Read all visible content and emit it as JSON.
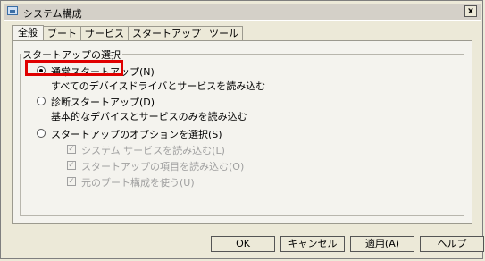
{
  "window": {
    "title": "システム構成",
    "close_label": "x"
  },
  "tabs": [
    {
      "label": "全般"
    },
    {
      "label": "ブート"
    },
    {
      "label": "サービス"
    },
    {
      "label": "スタートアップ"
    },
    {
      "label": "ツール"
    }
  ],
  "startup_group": {
    "title": "スタートアップの選択",
    "options": [
      {
        "label": "通常スタートアップ(N)",
        "description": "すべてのデバイスドライバとサービスを読み込む",
        "selected": true
      },
      {
        "label": "診断スタートアップ(D)",
        "description": "基本的なデバイスとサービスのみを読み込む",
        "selected": false
      },
      {
        "label": "スタートアップのオプションを選択(S)",
        "description": "",
        "selected": false
      }
    ],
    "sub_options": [
      {
        "label": "システム サービスを読み込む(L)",
        "checked": true
      },
      {
        "label": "スタートアップの項目を読み込む(O)",
        "checked": true
      },
      {
        "label": "元のブート構成を使う(U)",
        "checked": true
      }
    ]
  },
  "buttons": {
    "ok": "OK",
    "cancel": "キャンセル",
    "apply": "適用(A)",
    "help": "ヘルプ"
  },
  "highlight_color": "#e00000"
}
